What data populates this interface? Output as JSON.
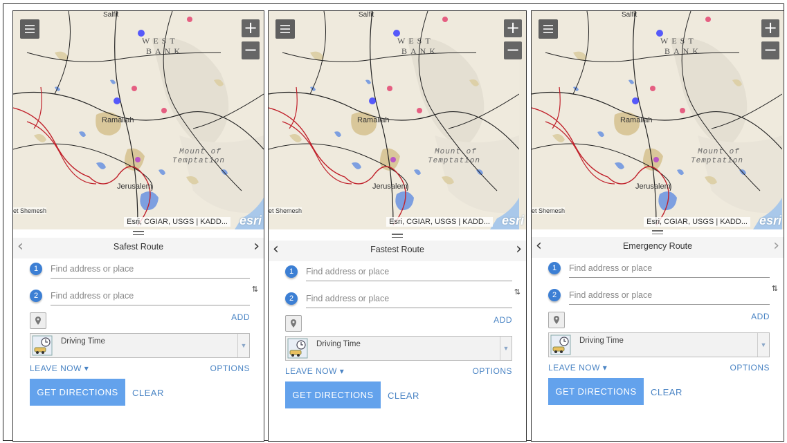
{
  "panels": [
    {
      "route_title": "Safest Route",
      "stop1_number": "1",
      "stop1_placeholder": "Find address or place",
      "stop2_number": "2",
      "stop2_placeholder": "Find address or place",
      "swap_icon": "⇅",
      "add_label": "ADD",
      "travel_mode": "Driving Time",
      "leave_now_label": "LEAVE NOW ▾",
      "options_label": "OPTIONS",
      "get_directions_label": "GET DIRECTIONS",
      "clear_label": "CLEAR",
      "attribution": "Esri, CGIAR, USGS | KADD...",
      "esri_logo": "esri"
    },
    {
      "route_title": "Fastest Route",
      "stop1_number": "1",
      "stop1_placeholder": "Find address or place",
      "stop2_number": "2",
      "stop2_placeholder": "Find address or place",
      "swap_icon": "⇅",
      "add_label": "ADD",
      "travel_mode": "Driving Time",
      "leave_now_label": "LEAVE NOW ▾",
      "options_label": "OPTIONS",
      "get_directions_label": "GET DIRECTIONS",
      "clear_label": "CLEAR",
      "attribution": "Esri, CGIAR, USGS | KADD...",
      "esri_logo": "esri"
    },
    {
      "route_title": "Emergency Route",
      "stop1_number": "1",
      "stop1_placeholder": "Find address or place",
      "stop2_number": "2",
      "stop2_placeholder": "Find address or place",
      "swap_icon": "⇅",
      "add_label": "ADD",
      "travel_mode": "Driving Time",
      "leave_now_label": "LEAVE NOW ▾",
      "options_label": "OPTIONS",
      "get_directions_label": "GET DIRECTIONS",
      "clear_label": "CLEAR",
      "attribution": "Esri, CGIAR, USGS | KADD...",
      "esri_logo": "esri"
    }
  ],
  "map_labels": {
    "west": "WEST",
    "bank": "BANK",
    "ramallah": "Ramallah",
    "mount1": "Mount of",
    "mount2": "Temptation",
    "jerusalem": "Jerusalem",
    "shemesh": "et Shemesh",
    "salfit": "Salfit"
  },
  "controls": {
    "zoom_in": "+",
    "zoom_out": "−",
    "prev": "‹",
    "next": "›"
  },
  "colors": {
    "accent": "#63a2ec",
    "link": "#4a84c4",
    "stop_badge": "#3c7fd4",
    "map_bg": "#eee9dc",
    "border_red": "#c0202a"
  }
}
